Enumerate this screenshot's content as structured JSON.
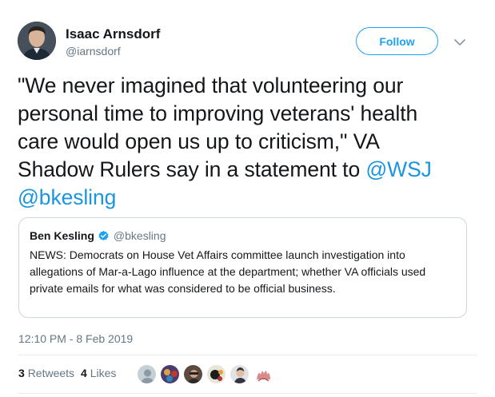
{
  "author": {
    "name": "Isaac Arnsdorf",
    "handle": "@iarnsdorf"
  },
  "follow_label": "Follow",
  "tweet": {
    "text_lines": [
      "\"We never imagined that volunteering our",
      "personal time to improving veterans' health",
      "care would open us up to criticism,\" VA",
      "Shadow Rulers say in a statement to "
    ],
    "mention_inline": "@WSJ",
    "mention_line": "@bkesling"
  },
  "quoted_tweet": {
    "name": "Ben Kesling",
    "handle": "@bkesling",
    "text_lines": [
      "NEWS: Democrats on House Vet Affairs committee launch investigation into",
      "allegations of Mar-a-Lago influence at the department; whether VA officials used",
      "private emails for what was considered to be official business."
    ]
  },
  "timestamp": "12:10 PM - 8 Feb 2019",
  "stats": {
    "retweets_count": "3",
    "retweets_label": "Retweets",
    "likes_count": "4",
    "likes_label": "Likes"
  },
  "icons": [
    "caret-down-icon",
    "verified-badge-icon"
  ],
  "colors": {
    "accent": "#1da1f2",
    "link": "#1b95e0",
    "secondary_text": "#657786",
    "border": "#ccd6dd"
  }
}
